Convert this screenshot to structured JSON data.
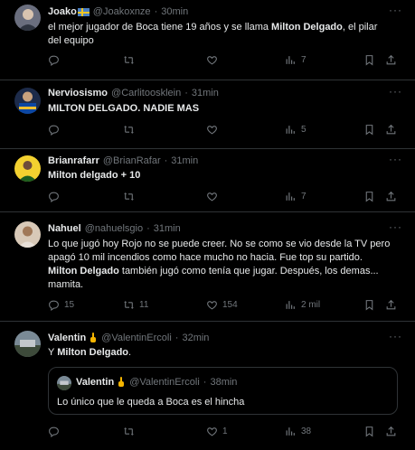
{
  "tweets": [
    {
      "name": "Joako",
      "handle": "@Joakoxnze",
      "sep": "·",
      "time": "30min",
      "text_a": "el mejor jugador de Boca tiene 19 años y se llama ",
      "text_b": "Milton Delgado",
      "text_c": ", el pilar",
      "text_d": "del equipo",
      "views": "7"
    },
    {
      "name": "Nerviosismo",
      "handle": "@Carlitoosklein",
      "sep": "·",
      "time": "31min",
      "text_a": "MILTON DELGADO",
      "text_b": ". NADIE MAS",
      "views": "5"
    },
    {
      "name": "Brianrafarr",
      "handle": "@BrianRafar",
      "sep": "·",
      "time": "31min",
      "text_a": "Milton delgado",
      "text_b": " + 10",
      "views": "7"
    },
    {
      "name": "Nahuel",
      "handle": "@nahuelsgio",
      "sep": "·",
      "time": "31min",
      "line1": "Lo que jugó hoy Rojo no se puede creer. No se como se vio desde la TV pero",
      "line2": "apagó 10 mil incendios como hace mucho no hacia. Fue top su partido.",
      "line3_bold": "Milton Delgado",
      "line3_rest": " también jugó como tenía que jugar. Después, los demas...",
      "line4": "mamita.",
      "replies": "15",
      "retweets": "11",
      "likes": "154",
      "views": "2 mil"
    },
    {
      "name": "Valentin",
      "handle": "@ValentinErcoli",
      "sep": "·",
      "time": "32min",
      "text_a": "Y ",
      "text_b": "Milton Delgado",
      "text_c": ".",
      "quote": {
        "name": "Valentin",
        "handle": "@ValentinErcoli",
        "sep": "·",
        "time": "38min",
        "text": "Lo único que le queda a Boca es el hincha"
      },
      "likes": "1",
      "views": "38"
    }
  ],
  "more": "···",
  "icons": {
    "reply": "reply-icon",
    "retweet": "retweet-icon",
    "like": "heart-icon",
    "views": "views-icon",
    "bookmark": "bookmark-icon",
    "share": "share-icon"
  },
  "colors": {
    "background": "#000000",
    "text": "#e7e9ea",
    "muted": "#71767b",
    "border": "#2f3336"
  }
}
